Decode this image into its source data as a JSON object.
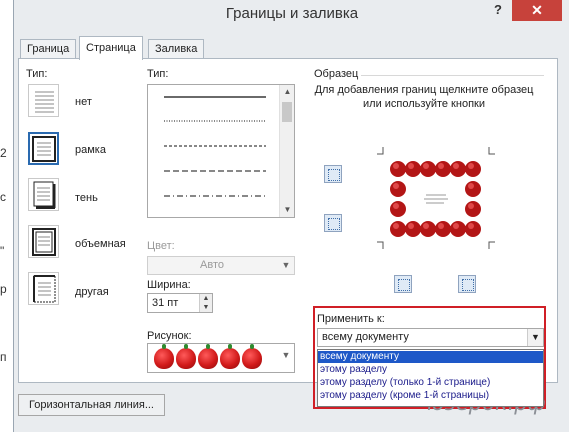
{
  "dialog": {
    "title": "Границы и заливка",
    "help": "?",
    "close": "✕"
  },
  "tabs": [
    {
      "label": "Граница"
    },
    {
      "label": "Страница"
    },
    {
      "label": "Заливка"
    }
  ],
  "type_section": {
    "label": "Тип:",
    "items": [
      {
        "label": "нет"
      },
      {
        "label": "рамка"
      },
      {
        "label": "тень"
      },
      {
        "label": "объемная"
      },
      {
        "label": "другая"
      }
    ]
  },
  "style_section": {
    "label": "Тип:",
    "color_label": "Цвет:",
    "color_value": "Авто",
    "width_label": "Ширина:",
    "width_value": "31 пт",
    "art_label": "Рисунок:",
    "art_label_underline_char": "к"
  },
  "preview": {
    "label": "Образец",
    "hint": "Для добавления границ щелкните образец или используйте кнопки"
  },
  "apply_to": {
    "label": "Применить к:",
    "value": "всему документу",
    "options": [
      {
        "label": "всему документу"
      },
      {
        "label": "этому разделу"
      },
      {
        "label": "этому разделу (только 1-й странице)"
      },
      {
        "label": "этому разделу (кроме 1-й страницы)"
      }
    ]
  },
  "buttons": {
    "horizontal_line": "Горизонтальная линия..."
  },
  "background_doc": {
    "chars": [
      "2",
      "с",
      "\"",
      "р",
      "п"
    ]
  },
  "watermark": "юзерок.рф",
  "colors": {
    "accent": "#1e58c8",
    "highlight_frame": "#d01f26",
    "close_button": "#c7423b"
  }
}
